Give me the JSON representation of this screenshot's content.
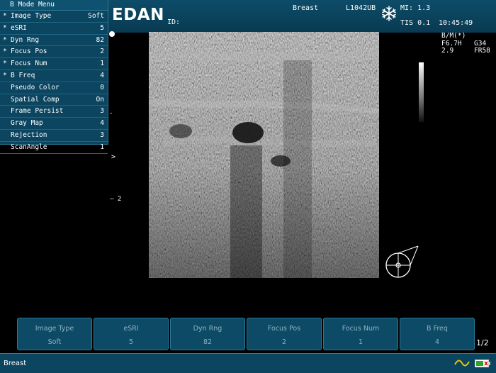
{
  "header": {
    "logo": "EDAN",
    "id_label": "ID:",
    "exam": "Breast",
    "probe": "L1042UB",
    "mi": "MI: 1.3",
    "tis": "TIS  0.1",
    "time": "10:45:49",
    "freeze_icon": "snowflake-icon"
  },
  "menu": {
    "title": "B Mode Menu",
    "items": [
      {
        "star": "*",
        "label": "Image Type",
        "value": "Soft"
      },
      {
        "star": "*",
        "label": "eSRI",
        "value": "5"
      },
      {
        "star": "*",
        "label": "Dyn Rng",
        "value": "82"
      },
      {
        "star": "*",
        "label": "Focus Pos",
        "value": "2"
      },
      {
        "star": "*",
        "label": "Focus Num",
        "value": "1"
      },
      {
        "star": "*",
        "label": "B Freq",
        "value": "4"
      },
      {
        "star": "",
        "label": "Pseudo Color",
        "value": "0"
      },
      {
        "star": "",
        "label": "Spatial Comp",
        "value": "On"
      },
      {
        "star": "",
        "label": "Frame Persist",
        "value": "3"
      },
      {
        "star": "",
        "label": "Gray Map",
        "value": "4"
      },
      {
        "star": "",
        "label": "Rejection",
        "value": "3"
      },
      {
        "star": "",
        "label": "ScanAngle",
        "value": "1"
      }
    ]
  },
  "image_params": {
    "mode": "B/M(*)",
    "freq": "F6.7H",
    "gain": "G34",
    "depth": "2.9",
    "frame_rate": "FR58"
  },
  "scale": {
    "tick": "-",
    "focus_marker": ">",
    "depth_marker": "— 2"
  },
  "softkeys": [
    {
      "title": "Image Type",
      "value": "Soft"
    },
    {
      "title": "eSRI",
      "value": "5"
    },
    {
      "title": "Dyn Rng",
      "value": "82"
    },
    {
      "title": "Focus Pos",
      "value": "2"
    },
    {
      "title": "Focus Num",
      "value": "1"
    },
    {
      "title": "B Freq",
      "value": "4"
    }
  ],
  "page_indicator": "1/2",
  "status": {
    "exam": "Breast",
    "icons": [
      "wave-icon",
      "battery-icon"
    ]
  },
  "colors": {
    "panel": "#0b4560",
    "border": "#2c7a9a",
    "softkey_text": "#8fb2c2"
  }
}
